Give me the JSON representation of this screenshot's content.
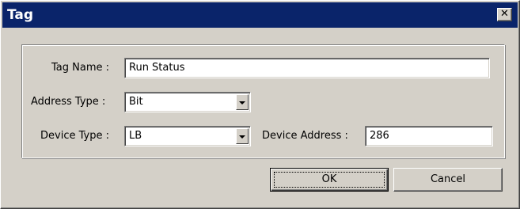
{
  "window": {
    "title": "Tag",
    "close_symbol": "✕"
  },
  "form": {
    "tag_name_label": "Tag Name :",
    "tag_name_value": "Run Status",
    "address_type_label": "Address Type :",
    "address_type_value": "Bit",
    "device_type_label": "Device Type :",
    "device_type_value": "LB",
    "device_address_label": "Device Address :",
    "device_address_value": "286"
  },
  "buttons": {
    "ok_label": "OK",
    "cancel_label": "Cancel"
  },
  "colors": {
    "titlebar": "#0a246a",
    "face": "#d4d0c8",
    "field": "#ffffff"
  }
}
